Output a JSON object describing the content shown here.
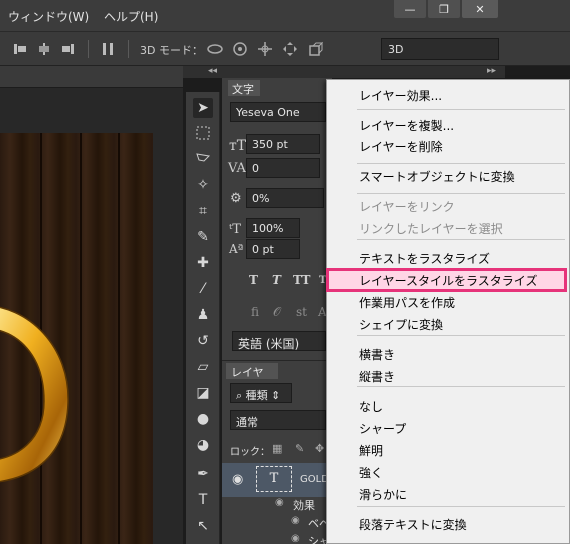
{
  "menubar": {
    "items": [
      "ウィンドウ(W)",
      "ヘルプ(H)"
    ],
    "window_controls": {
      "minimize": "—",
      "restore": "❐",
      "close": "✕"
    }
  },
  "options_bar": {
    "mode3d_label": "3D モード：",
    "select_3d_value": "3D"
  },
  "character_panel": {
    "tab_label": "文字",
    "font_family": "Yeseva One",
    "font_size": "350 pt",
    "kerning": "0",
    "tracking": "0%",
    "vertical_scale": "100%",
    "baseline_shift": "0 pt",
    "type_buttons": [
      "T",
      "T",
      "TT",
      "T"
    ],
    "ligature_buttons": [
      "fi",
      "𝒪",
      "st",
      "A"
    ],
    "language": "英語 (米国)"
  },
  "layers_panel": {
    "tab_label": "レイヤー",
    "filter_kind": "種類",
    "blend_mode": "通常",
    "lock_label": "ロック：",
    "layer_name": "GOLD",
    "effects_label": "効果",
    "effect_items": [
      "ベベ",
      "シャ"
    ]
  },
  "context_menu": {
    "highlight_color": "#e6337a",
    "items": [
      {
        "label": "レイヤー効果...",
        "enabled": true
      },
      {
        "label": "レイヤーを複製...",
        "enabled": true
      },
      {
        "label": "レイヤーを削除",
        "enabled": true
      },
      {
        "label": "スマートオブジェクトに変換",
        "enabled": true
      },
      {
        "label": "レイヤーをリンク",
        "enabled": false
      },
      {
        "label": "リンクしたレイヤーを選択",
        "enabled": false
      },
      {
        "label": "テキストをラスタライズ",
        "enabled": true
      },
      {
        "label": "レイヤースタイルをラスタライズ",
        "enabled": true,
        "highlighted": true
      },
      {
        "label": "作業用パスを作成",
        "enabled": true
      },
      {
        "label": "シェイプに変換",
        "enabled": true
      },
      {
        "label": "横書き",
        "enabled": true
      },
      {
        "label": "縦書き",
        "enabled": true
      },
      {
        "label": "なし",
        "enabled": true
      },
      {
        "label": "シャープ",
        "enabled": true
      },
      {
        "label": "鮮明",
        "enabled": true
      },
      {
        "label": "強く",
        "enabled": true
      },
      {
        "label": "滑らかに",
        "enabled": true
      },
      {
        "label": "段落テキストに変換",
        "enabled": true
      }
    ]
  }
}
